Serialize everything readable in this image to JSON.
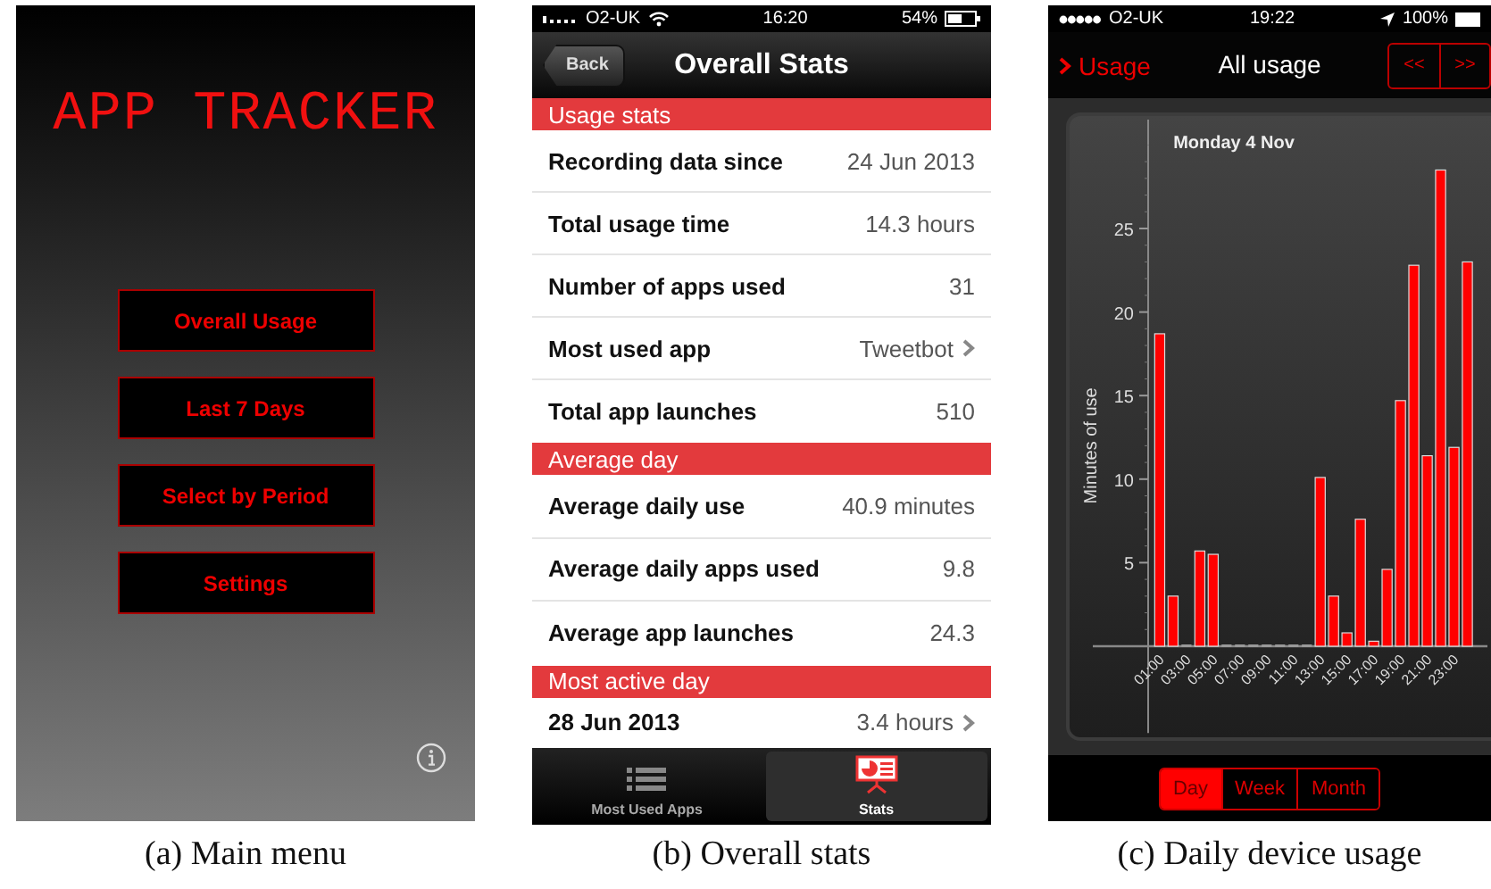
{
  "main_menu": {
    "title": "APP TRACKER",
    "buttons": [
      "Overall Usage",
      "Last 7 Days",
      "Select by Period",
      "Settings"
    ],
    "caption": "(a) Main menu"
  },
  "overall_stats": {
    "status_bar": {
      "carrier": "O2-UK",
      "time": "16:20",
      "battery": "54%"
    },
    "nav": {
      "back": "Back",
      "title": "Overall Stats"
    },
    "sections": [
      {
        "header": "Usage stats",
        "rows": [
          {
            "label": "Recording data since",
            "value": "24 Jun 2013",
            "disclosure": false
          },
          {
            "label": "Total usage time",
            "value": "14.3 hours",
            "disclosure": false
          },
          {
            "label": "Number of apps used",
            "value": "31",
            "disclosure": false
          },
          {
            "label": "Most used app",
            "value": "Tweetbot",
            "disclosure": true
          },
          {
            "label": "Total app launches",
            "value": "510",
            "disclosure": false
          }
        ]
      },
      {
        "header": "Average day",
        "rows": [
          {
            "label": "Average daily use",
            "value": "40.9 minutes",
            "disclosure": false
          },
          {
            "label": "Average daily apps used",
            "value": "9.8",
            "disclosure": false
          },
          {
            "label": "Average app launches",
            "value": "24.3",
            "disclosure": false
          }
        ]
      },
      {
        "header": "Most active day",
        "rows": [
          {
            "label": "28 Jun 2013",
            "value": "3.4 hours",
            "disclosure": true
          }
        ]
      }
    ],
    "tabs": [
      {
        "label": "Most Used Apps",
        "kind": "list",
        "selected": false
      },
      {
        "label": "Stats",
        "kind": "stats",
        "selected": true
      }
    ],
    "caption": "(b) Overall stats"
  },
  "daily_usage": {
    "status_bar": {
      "carrier": "O2-UK",
      "time": "19:22",
      "battery": "100%"
    },
    "nav": {
      "back": "Usage",
      "title": "All usage",
      "pager": [
        "<<",
        ">>"
      ]
    },
    "chart_data": {
      "type": "bar",
      "title": "Monday 4 Nov",
      "ylabel": "Minutes of use",
      "x": [
        1,
        2,
        3,
        4,
        5,
        6,
        7,
        8,
        9,
        10,
        11,
        12,
        13,
        14,
        15,
        16,
        17,
        18,
        19,
        20,
        21,
        22,
        23,
        24
      ],
      "values": [
        18.7,
        3.0,
        0,
        5.7,
        5.5,
        0,
        0,
        0,
        0,
        0,
        0,
        0,
        10.1,
        3.0,
        0.8,
        7.6,
        0.3,
        4.6,
        14.7,
        22.8,
        11.4,
        28.5,
        11.9,
        23.0
      ],
      "xlim": [
        -4,
        25.5
      ],
      "ylim": [
        -5.2,
        30
      ],
      "yticks": [
        5,
        10,
        15,
        20,
        25
      ],
      "xticks": [
        {
          "value": 1,
          "label": "01:00"
        },
        {
          "value": 3,
          "label": "03:00"
        },
        {
          "value": 5,
          "label": "05:00"
        },
        {
          "value": 7,
          "label": "07:00"
        },
        {
          "value": 9,
          "label": "09:00"
        },
        {
          "value": 11,
          "label": "11:00"
        },
        {
          "value": 13,
          "label": "13:00"
        },
        {
          "value": 15,
          "label": "15:00"
        },
        {
          "value": 17,
          "label": "17:00"
        },
        {
          "value": 19,
          "label": "19:00"
        },
        {
          "value": 21,
          "label": "21:00"
        },
        {
          "value": 23,
          "label": "23:00"
        }
      ]
    },
    "periods": [
      {
        "label": "Day",
        "selected": true
      },
      {
        "label": "Week",
        "selected": false
      },
      {
        "label": "Month",
        "selected": false
      }
    ],
    "caption": "(c) Daily device usage"
  }
}
